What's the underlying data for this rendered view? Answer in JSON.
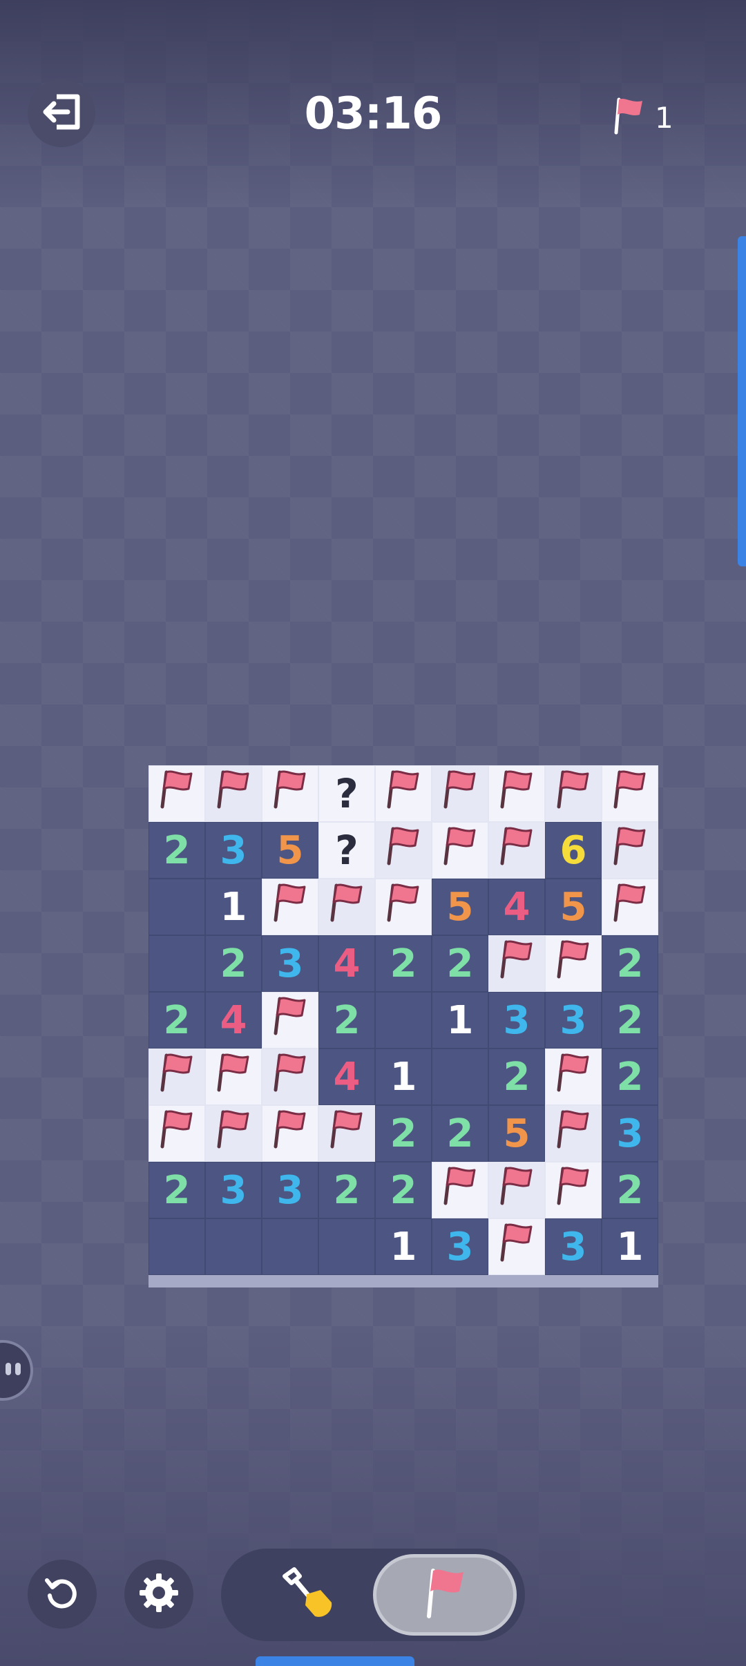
{
  "header": {
    "timer": "03:16",
    "flag_count": "1"
  },
  "icons": {
    "exit": "exit-icon",
    "flag": "flag-icon",
    "restart": "restart-icon",
    "settings": "gear-icon",
    "dig": "shovel-icon",
    "helper": "helper-icon"
  },
  "colors": {
    "accent": "#3b84e6",
    "flag": "#f0758f",
    "revealed_cell": "#4d5682",
    "covered_cell": "#f3f4fb"
  },
  "board": {
    "rows": 9,
    "cols": 9,
    "cells": [
      [
        "F",
        "F",
        "F",
        "?",
        "F",
        "F",
        "F",
        "F",
        "F"
      ],
      [
        "2",
        "3",
        "5",
        "?",
        "F",
        "F",
        "F",
        "6",
        "F"
      ],
      [
        "",
        "1",
        "F",
        "F",
        "F",
        "5",
        "4",
        "5",
        "F"
      ],
      [
        "",
        "2",
        "3",
        "4",
        "2",
        "2",
        "F",
        "F",
        "2"
      ],
      [
        "2",
        "4",
        "F",
        "2",
        "",
        "1",
        "3",
        "3",
        "2"
      ],
      [
        "F",
        "F",
        "F",
        "4",
        "1",
        "",
        "2",
        "F",
        "2"
      ],
      [
        "F",
        "F",
        "F",
        "F",
        "2",
        "2",
        "5",
        "F",
        "3"
      ],
      [
        "2",
        "3",
        "3",
        "2",
        "2",
        "F",
        "F",
        "F",
        "2"
      ],
      [
        "",
        "",
        "",
        "",
        "1",
        "3",
        "F",
        "3",
        "1"
      ]
    ]
  },
  "mode": {
    "options": [
      "dig",
      "flag"
    ],
    "selected": "flag"
  }
}
